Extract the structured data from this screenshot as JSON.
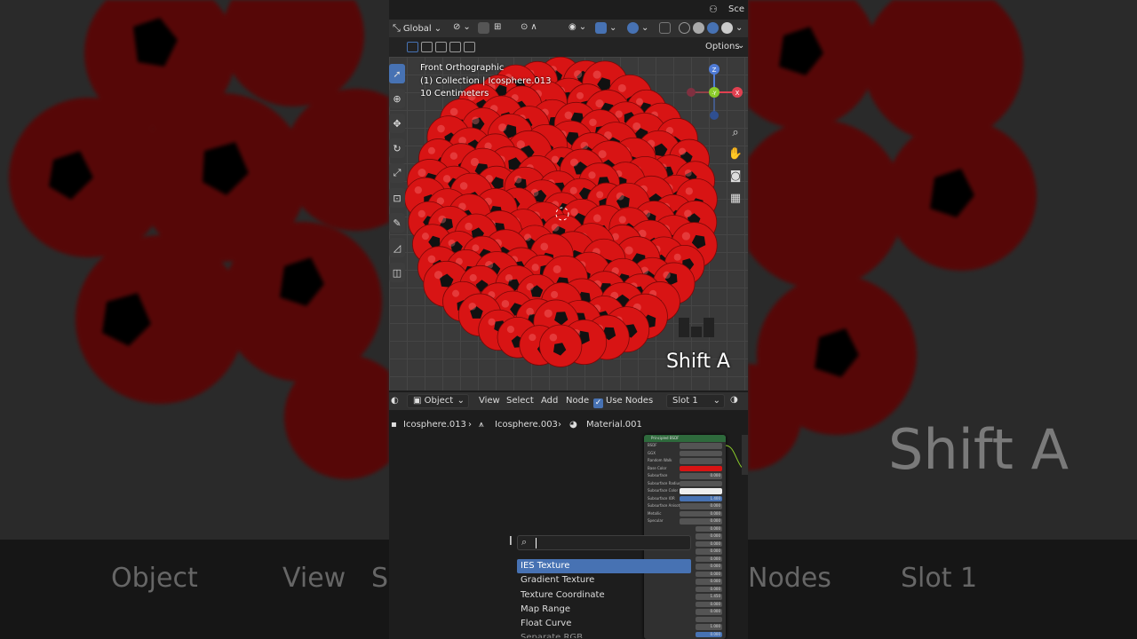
{
  "viewport_header": {
    "transform_orientation": "Global",
    "options_label": "Options",
    "scene_label": "Sce"
  },
  "viewport_info": {
    "view_name": "Front Orthographic",
    "collection": "(1) Collection | Icosphere.013",
    "scale": "10 Centimeters"
  },
  "overlay_hint": "Shift A",
  "gizmo": {
    "z": "Z",
    "y": "-Y",
    "x": "X"
  },
  "node_header": {
    "mode": "Object",
    "menus": [
      "View",
      "Select",
      "Add",
      "Node"
    ],
    "use_nodes_label": "Use Nodes",
    "slot": "Slot 1"
  },
  "breadcrumb": {
    "object": "Icosphere.013",
    "mesh": "Icosphere.003",
    "material": "Material.001"
  },
  "node": {
    "title": "Principled BSDF",
    "rows": [
      {
        "label": "BSDF",
        "value": ""
      },
      {
        "label": "GGX",
        "value": ""
      },
      {
        "label": "Random Walk",
        "value": ""
      },
      {
        "label": "Base Color",
        "value": ""
      },
      {
        "label": "Subsurface",
        "value": "0.000"
      },
      {
        "label": "Subsurface Radius",
        "value": ""
      },
      {
        "label": "Subsurface Color",
        "value": ""
      },
      {
        "label": "Subsurface IOR",
        "value": "1.400"
      },
      {
        "label": "Subsurface Anisotropy",
        "value": "0.000"
      },
      {
        "label": "Metallic",
        "value": "0.000"
      },
      {
        "label": "Specular",
        "value": "0.000"
      }
    ],
    "extra_values": [
      "0.000",
      "0.000",
      "0.000",
      "0.000",
      "0.000",
      "0.000",
      "0.000",
      "0.000",
      "0.000",
      "1.450",
      "0.000",
      "0.000",
      "",
      "1.000",
      "0.000"
    ]
  },
  "search": {
    "results": [
      "IES Texture",
      "Gradient Texture",
      "Texture Coordinate",
      "Map Range",
      "Float Curve",
      "Separate RGB"
    ],
    "selected_index": 0
  },
  "blurred_side": {
    "mode": "Object",
    "view": "View",
    "select_fragment": "S",
    "nodes_fragment": "Nodes",
    "slot": "Slot 1",
    "hint": "Shift A"
  },
  "colors": {
    "accent": "#4772b3",
    "ball_red": "#d81414",
    "ball_black": "#111111",
    "node_header": "#2e6a3c"
  }
}
